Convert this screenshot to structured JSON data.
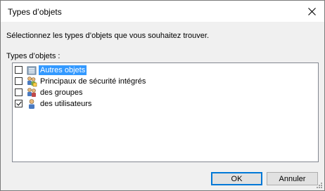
{
  "window": {
    "title": "Types d’objets",
    "close_icon": "close-icon"
  },
  "prompt": "Sélectionnez les types d’objets que vous souhaitez trouver.",
  "list_label": "Types d’objets :",
  "items": [
    {
      "label": "Autres objets",
      "icon": "folder-objects-icon",
      "checked": false,
      "selected": true
    },
    {
      "label": "Principaux de sécurité intégrés",
      "icon": "security-principals-icon",
      "checked": false,
      "selected": false
    },
    {
      "label": "des groupes",
      "icon": "groups-icon",
      "checked": false,
      "selected": false
    },
    {
      "label": "des utilisateurs",
      "icon": "user-icon",
      "checked": true,
      "selected": false
    }
  ],
  "buttons": {
    "ok": "OK",
    "cancel": "Annuler"
  },
  "colors": {
    "selection": "#3399ff",
    "dialog_bg": "#f0f0f0",
    "default_button_border": "#0078d7"
  }
}
